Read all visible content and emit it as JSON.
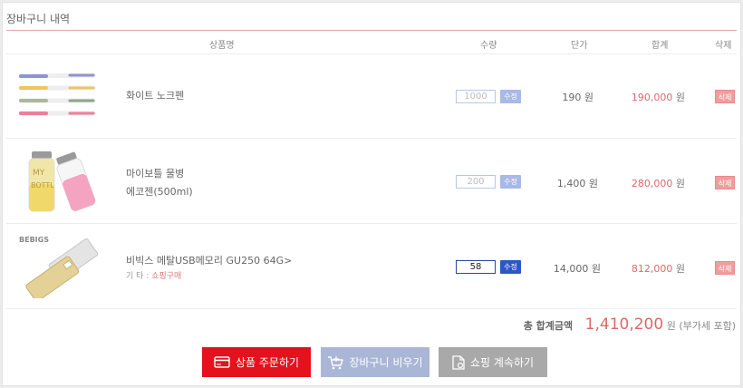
{
  "cart_title": "장바구니 내역",
  "columns": {
    "product": "상품명",
    "qty": "수량",
    "unit_price": "단가",
    "total": "합계",
    "delete": "삭제"
  },
  "items": [
    {
      "name_line1": "화이트 노크펜",
      "name_line2": "",
      "option_key": "",
      "option_value": "",
      "qty": "1000",
      "edit": "수정",
      "unit_price": "190 원",
      "total_value": "190,000",
      "total_unit": "원",
      "delete": "삭제",
      "icon": "pens-image"
    },
    {
      "name_line1": "마이보틀 물병",
      "name_line2": "에코젠(500ml)",
      "option_key": "",
      "option_value": "",
      "qty": "200",
      "edit": "수정",
      "unit_price": "1,400 원",
      "total_value": "280,000",
      "total_unit": "원",
      "delete": "삭제",
      "icon": "bottles-image"
    },
    {
      "name_line1": "비빅스 메탈USB메모리 GU250 64G>",
      "name_line2": "",
      "option_key": "기 타 : ",
      "option_value": "쇼핑구매",
      "qty": "58",
      "edit": "수정",
      "unit_price": "14,000 원",
      "total_value": "812,000",
      "total_unit": "원",
      "delete": "삭제",
      "icon": "usb-image",
      "thumb_brand": "BEBIGS"
    }
  ],
  "summary": {
    "label": "총 합계금액",
    "amount": "1,410,200",
    "suffix": "원 (부가세 포함)"
  },
  "buttons": {
    "order": {
      "label": "상품 주문하기",
      "color": "#e4121d",
      "icon": "card-icon"
    },
    "empty": {
      "label": "장바구니 비우기",
      "color": "#a9b6d6",
      "icon": "cart-icon"
    },
    "continue": {
      "label": "쇼핑 계속하기",
      "color": "#a9a9a9",
      "icon": "document-icon"
    }
  }
}
